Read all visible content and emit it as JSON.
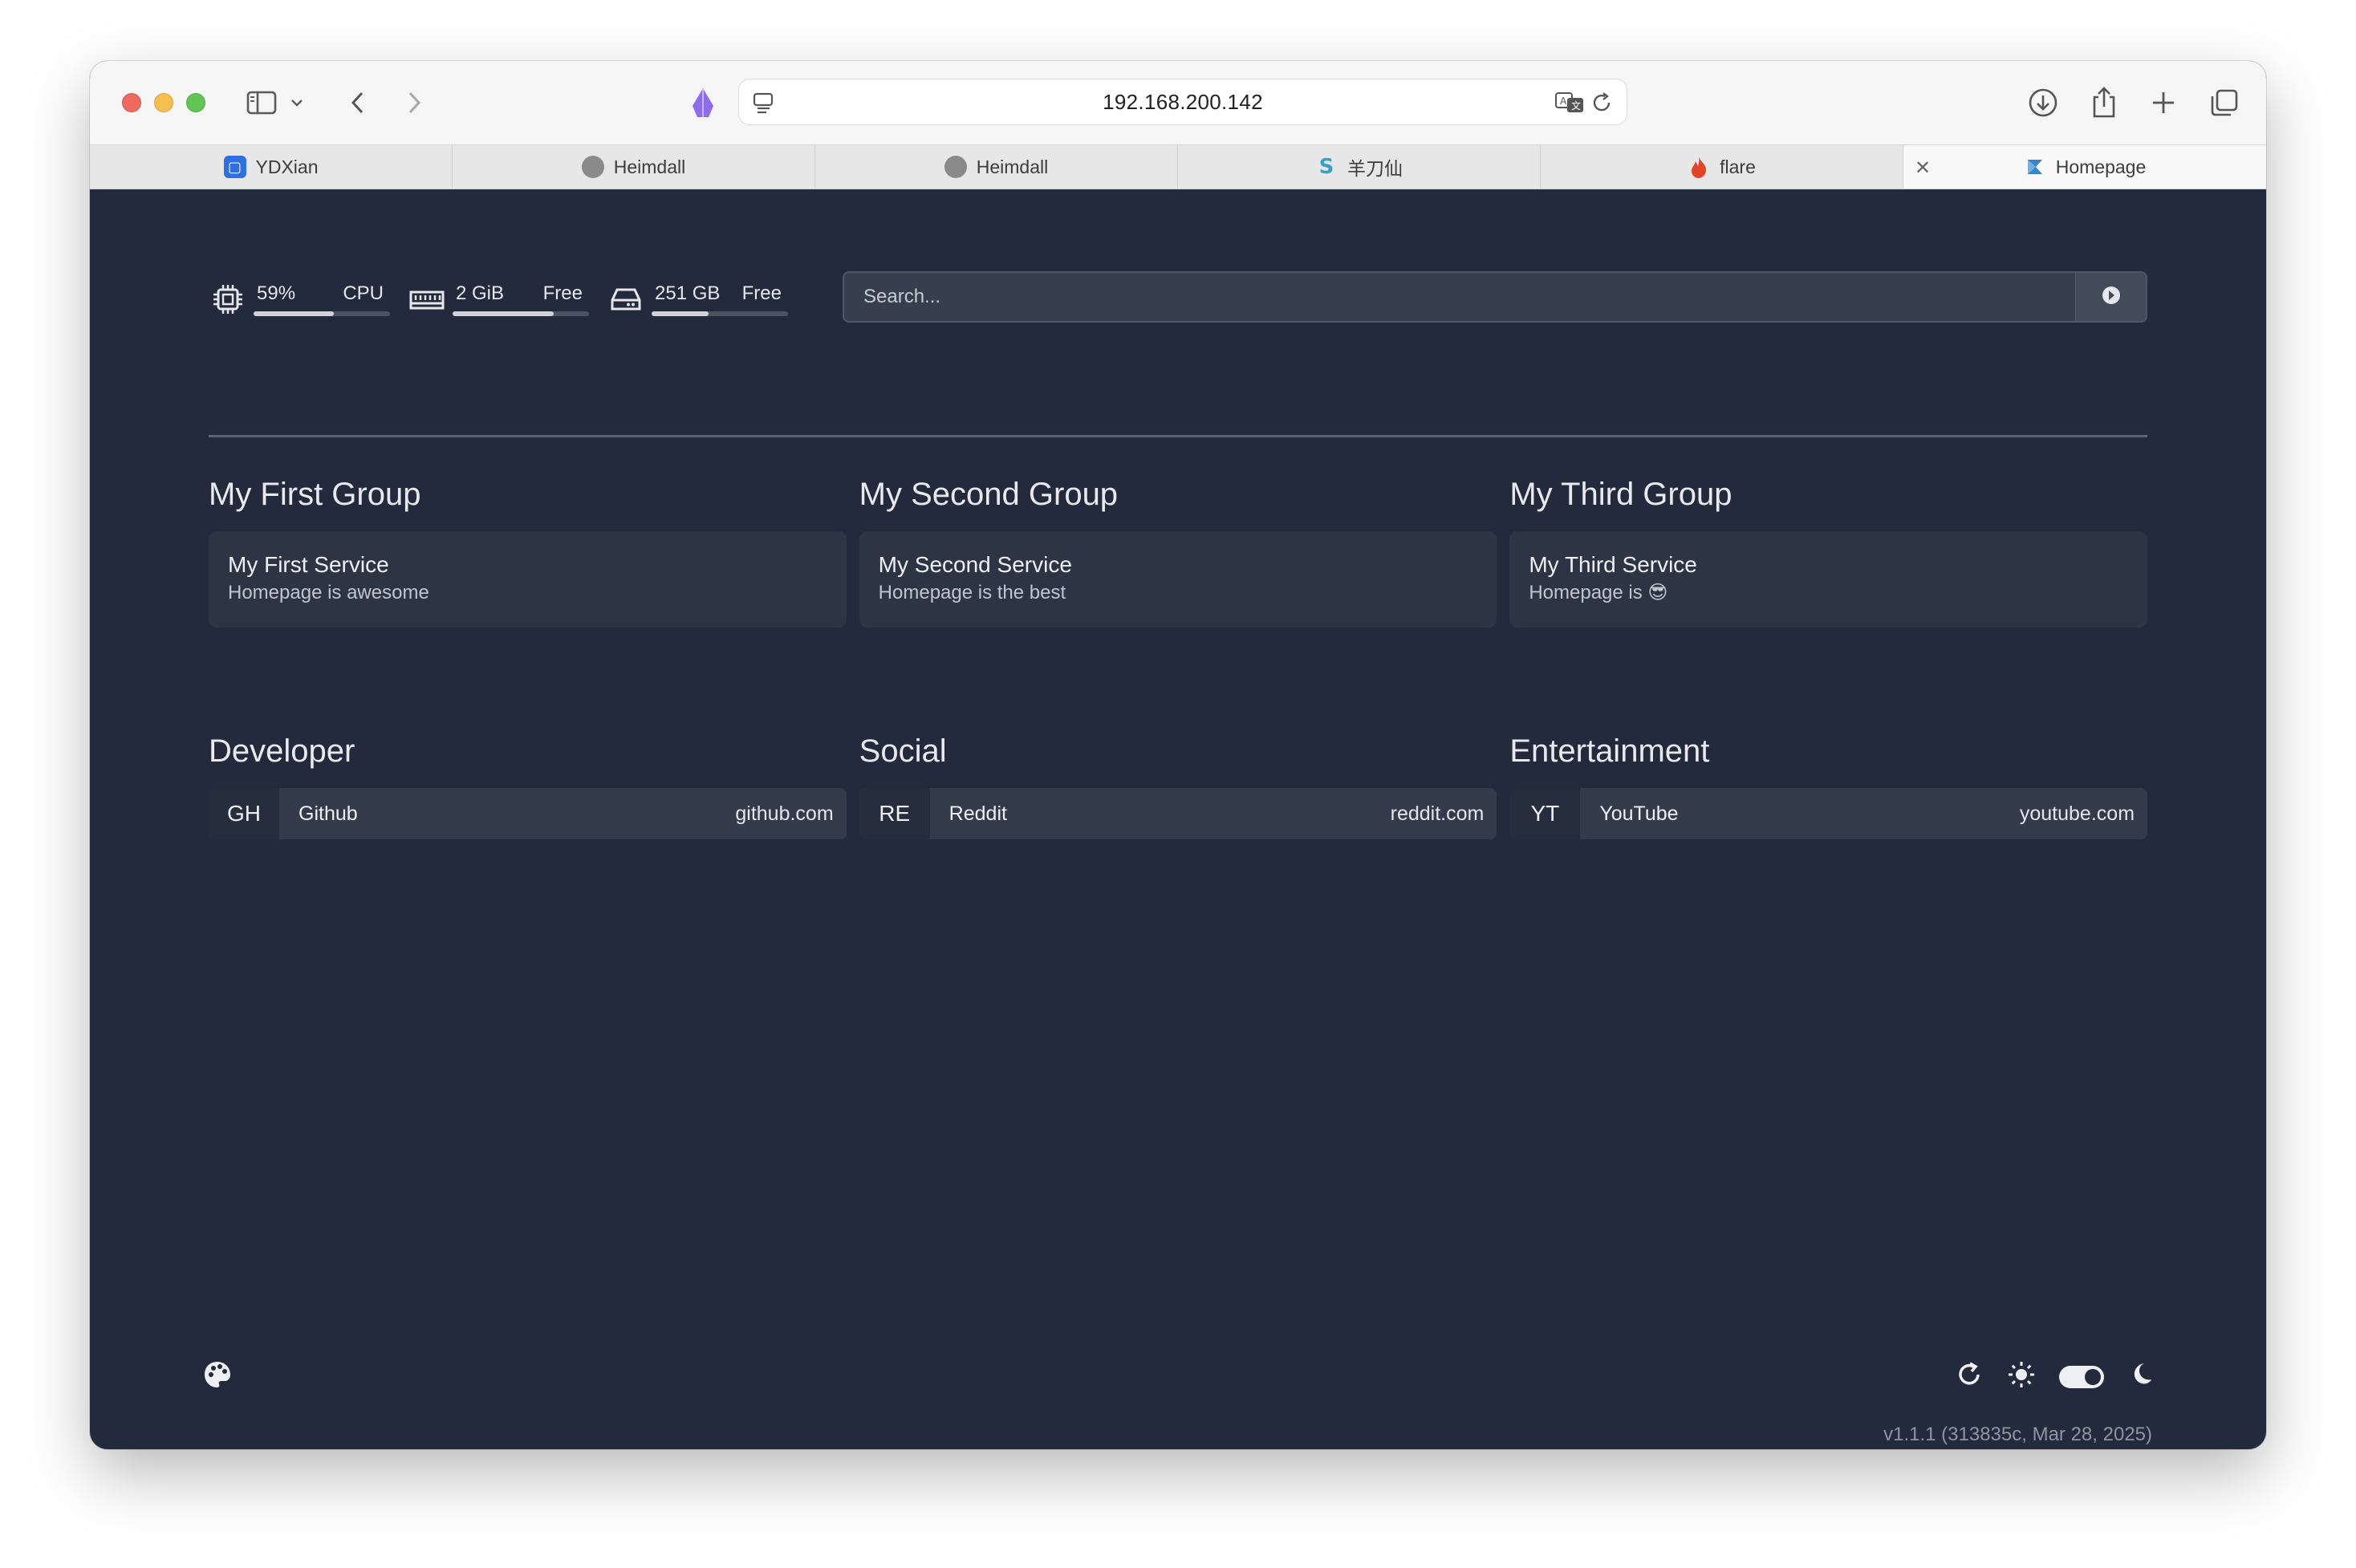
{
  "browser": {
    "url": "192.168.200.142",
    "tabs": [
      {
        "label": "YDXian",
        "icon": "ydxian-favicon"
      },
      {
        "label": "Heimdall",
        "icon": "heimdall-favicon"
      },
      {
        "label": "Heimdall",
        "icon": "heimdall-favicon"
      },
      {
        "label": "羊刀仙",
        "icon": "s-logo-favicon"
      },
      {
        "label": "flare",
        "icon": "flame-favicon"
      },
      {
        "label": "Homepage",
        "icon": "homepage-favicon",
        "active": true
      }
    ]
  },
  "widgets": {
    "cpu": {
      "value": "59%",
      "label": "CPU",
      "usage_fraction": 0.59,
      "icon": "cpu-icon"
    },
    "memory": {
      "value": "2 GiB",
      "label": "Free",
      "usage_fraction": 0.74,
      "icon": "memory-icon"
    },
    "disk": {
      "value": "251 GB",
      "label": "Free",
      "usage_fraction": 0.42,
      "icon": "disk-icon"
    }
  },
  "search": {
    "placeholder": "Search...",
    "provider_icon": "search-provider-icon"
  },
  "service_groups": [
    {
      "title": "My First Group",
      "service": {
        "name": "My First Service",
        "description": "Homepage is awesome"
      }
    },
    {
      "title": "My Second Group",
      "service": {
        "name": "My Second Service",
        "description": "Homepage is the best"
      }
    },
    {
      "title": "My Third Group",
      "service": {
        "name": "My Third Service",
        "description": "Homepage is 😎"
      }
    }
  ],
  "bookmark_groups": [
    {
      "title": "Developer",
      "bookmark": {
        "abbr": "GH",
        "name": "Github",
        "url": "github.com"
      }
    },
    {
      "title": "Social",
      "bookmark": {
        "abbr": "RE",
        "name": "Reddit",
        "url": "reddit.com"
      }
    },
    {
      "title": "Entertainment",
      "bookmark": {
        "abbr": "YT",
        "name": "YouTube",
        "url": "youtube.com"
      }
    }
  ],
  "footer": {
    "version": "v1.1.1 (313835c, Mar 28, 2025)",
    "icons": [
      "palette-icon",
      "refresh-icon",
      "sun-icon",
      "theme-toggle",
      "moon-icon"
    ]
  },
  "colors": {
    "background": "#222a3b",
    "card": "#2d3545",
    "text": "#e5e7eb"
  }
}
